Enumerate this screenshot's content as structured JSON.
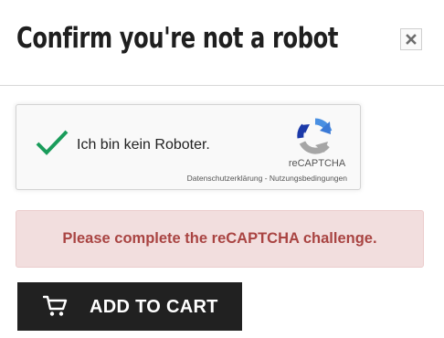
{
  "modal": {
    "title": "Confirm you're not a robot",
    "close_icon": "close-icon"
  },
  "recaptcha": {
    "checked": true,
    "label": "Ich bin kein Roboter.",
    "brand": "reCAPTCHA",
    "privacy_link": "Datenschutzerklärung",
    "separator": " - ",
    "terms_link": "Nutzungsbedingungen",
    "check_color": "#1a9c5b",
    "logo_icon": "recaptcha-logo-icon"
  },
  "alert": {
    "message": "Please complete the reCAPTCHA challenge.",
    "background": "#f2dede",
    "text_color": "#a94442"
  },
  "cart_button": {
    "label": "ADD TO CART",
    "icon": "cart-icon",
    "background": "#212121"
  }
}
